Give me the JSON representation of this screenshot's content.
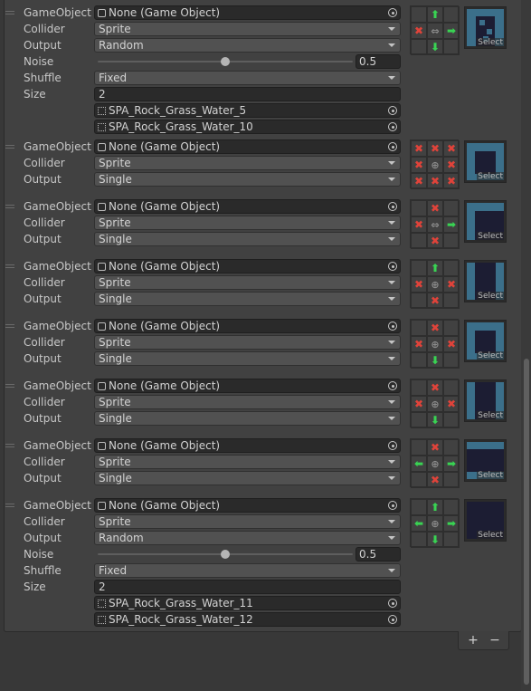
{
  "labels": {
    "gameobject": "GameObject",
    "collider": "Collider",
    "output": "Output",
    "noise": "Noise",
    "shuffle": "Shuffle",
    "size": "Size"
  },
  "none_value": "None (Game Object)",
  "select_label": "Select",
  "rules": [
    {
      "collider": "Sprite",
      "output": "Random",
      "noise": {
        "value": "0.5",
        "fraction": 0.5
      },
      "shuffle": "Fixed",
      "size": "2",
      "sprites": [
        "SPA_Rock_Grass_Water_5",
        "SPA_Rock_Grass_Water_10"
      ],
      "neighbors": [
        "",
        "up",
        "",
        "x",
        "swap",
        "right",
        "",
        "down",
        ""
      ]
    },
    {
      "collider": "Sprite",
      "output": "Single",
      "neighbors": [
        "x",
        "x",
        "x",
        "x",
        "center",
        "x",
        "x",
        "x",
        "x"
      ]
    },
    {
      "collider": "Sprite",
      "output": "Single",
      "neighbors": [
        "",
        "x",
        "",
        "x",
        "swap",
        "right",
        "",
        "x",
        ""
      ]
    },
    {
      "collider": "Sprite",
      "output": "Single",
      "neighbors": [
        "",
        "up",
        "",
        "x",
        "center",
        "x",
        "",
        "x",
        ""
      ]
    },
    {
      "collider": "Sprite",
      "output": "Single",
      "neighbors": [
        "",
        "x",
        "",
        "x",
        "center",
        "x",
        "",
        "down",
        ""
      ]
    },
    {
      "collider": "Sprite",
      "output": "Single",
      "neighbors": [
        "",
        "x",
        "",
        "x",
        "center",
        "x",
        "",
        "down",
        ""
      ]
    },
    {
      "collider": "Sprite",
      "output": "Single",
      "neighbors": [
        "",
        "x",
        "",
        "left",
        "center",
        "right",
        "",
        "x",
        ""
      ]
    },
    {
      "collider": "Sprite",
      "output": "Random",
      "noise": {
        "value": "0.5",
        "fraction": 0.5
      },
      "shuffle": "Fixed",
      "size": "2",
      "sprites": [
        "SPA_Rock_Grass_Water_11",
        "SPA_Rock_Grass_Water_12"
      ],
      "neighbors": [
        "",
        "up",
        "",
        "left",
        "center",
        "right",
        "",
        "down",
        ""
      ]
    }
  ],
  "footer": {
    "add": "+",
    "remove": "−"
  },
  "icons": {
    "x": "cross-icon",
    "up": "arrow-up-icon",
    "down": "arrow-down-icon",
    "left": "arrow-left-icon",
    "right": "arrow-right-icon",
    "swap": "swap-arrows-icon",
    "center": "center-dot-icon"
  },
  "colors": {
    "cross": "#e0433a",
    "arrow": "#39d353",
    "tile": "#1c1d33",
    "tile_edge": "#3b6f8a"
  }
}
